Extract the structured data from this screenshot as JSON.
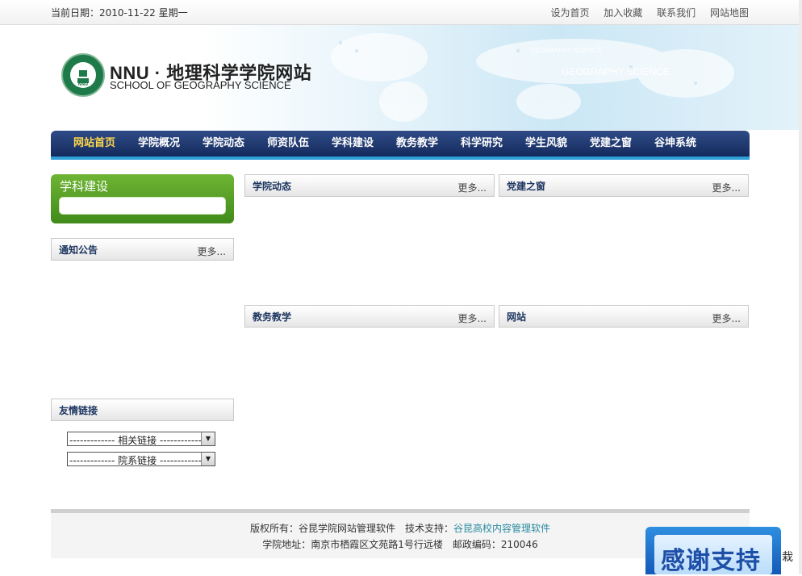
{
  "topbar": {
    "date_label": "当前日期：",
    "date_value": "2010-11-22 星期一",
    "links": [
      "设为首页",
      "加入收藏",
      "联系我们",
      "网站地图"
    ]
  },
  "header": {
    "title": "NNU · 地理科学学院网站",
    "subtitle": "SCHOOL OF GEOGRAPHY SCIENCE",
    "banner_big_text": "GEOGRAPHY SCIENCE",
    "banner_small_text": "GEOGRAPHY SCIENCE",
    "logo_text": "NNU"
  },
  "nav": {
    "items": [
      "网站首页",
      "学院概况",
      "学院动态",
      "师资队伍",
      "学科建设",
      "教务教学",
      "科学研究",
      "学生风貌",
      "党建之窗",
      "谷坤系统"
    ],
    "active_color": "#ffd84a"
  },
  "sidebar": {
    "discipline_title": "学科建设",
    "notice_title": "通知公告",
    "notice_more": "更多...",
    "links_title": "友情链接",
    "select_related": "------------- 相关链接 -------------",
    "select_dept": "------------- 院系链接 -------------"
  },
  "main": {
    "panels": [
      {
        "title": "学院动态",
        "more": "更多..."
      },
      {
        "title": "党建之窗",
        "more": "更多..."
      },
      {
        "title": "教务教学",
        "more": "更多..."
      },
      {
        "title": "网站",
        "more": "更多..."
      }
    ]
  },
  "footer": {
    "copyright_label": "版权所有：谷昆学院网站管理软件",
    "support_label": "技术支持：",
    "support_link": "谷昆高校内容管理软件",
    "address": "学院地址：南京市栖霞区文苑路1号行远楼　邮政编码：210046"
  },
  "float": {
    "thanks": "感谢支持",
    "side_char": "栽"
  },
  "colors": {
    "nav_dark": "#142a5d",
    "nav_accent": "#2f9fd8",
    "green": "#3f8a1a",
    "title_blue": "#1d3560"
  }
}
